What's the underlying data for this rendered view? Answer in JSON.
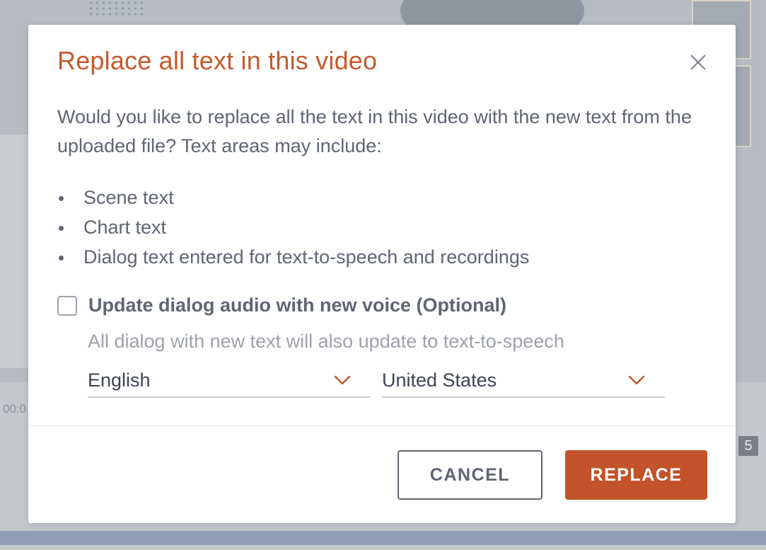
{
  "background": {
    "timecode": "00:0",
    "badge": "5"
  },
  "dialog": {
    "title": "Replace all text in this video",
    "close_icon": "close-icon",
    "description": "Would you like to replace all the text in this video with the new text from the uploaded file? Text areas may include:",
    "bullets": [
      "Scene text",
      "Chart text",
      "Dialog text entered for text-to-speech and recordings"
    ],
    "voice_option": {
      "label": "Update dialog audio with new voice (Optional)",
      "checked": false,
      "helper": "All dialog with new text will also update to text-to-speech"
    },
    "language_select": {
      "value": "English",
      "icon": "chevron-down-icon"
    },
    "region_select": {
      "value": "United States",
      "icon": "chevron-down-icon"
    },
    "buttons": {
      "cancel": "CANCEL",
      "replace": "REPLACE"
    }
  },
  "colors": {
    "accent": "#c3532a",
    "title": "#c65a2c",
    "text": "#5f6573",
    "muted_text": "#9da1aa"
  }
}
